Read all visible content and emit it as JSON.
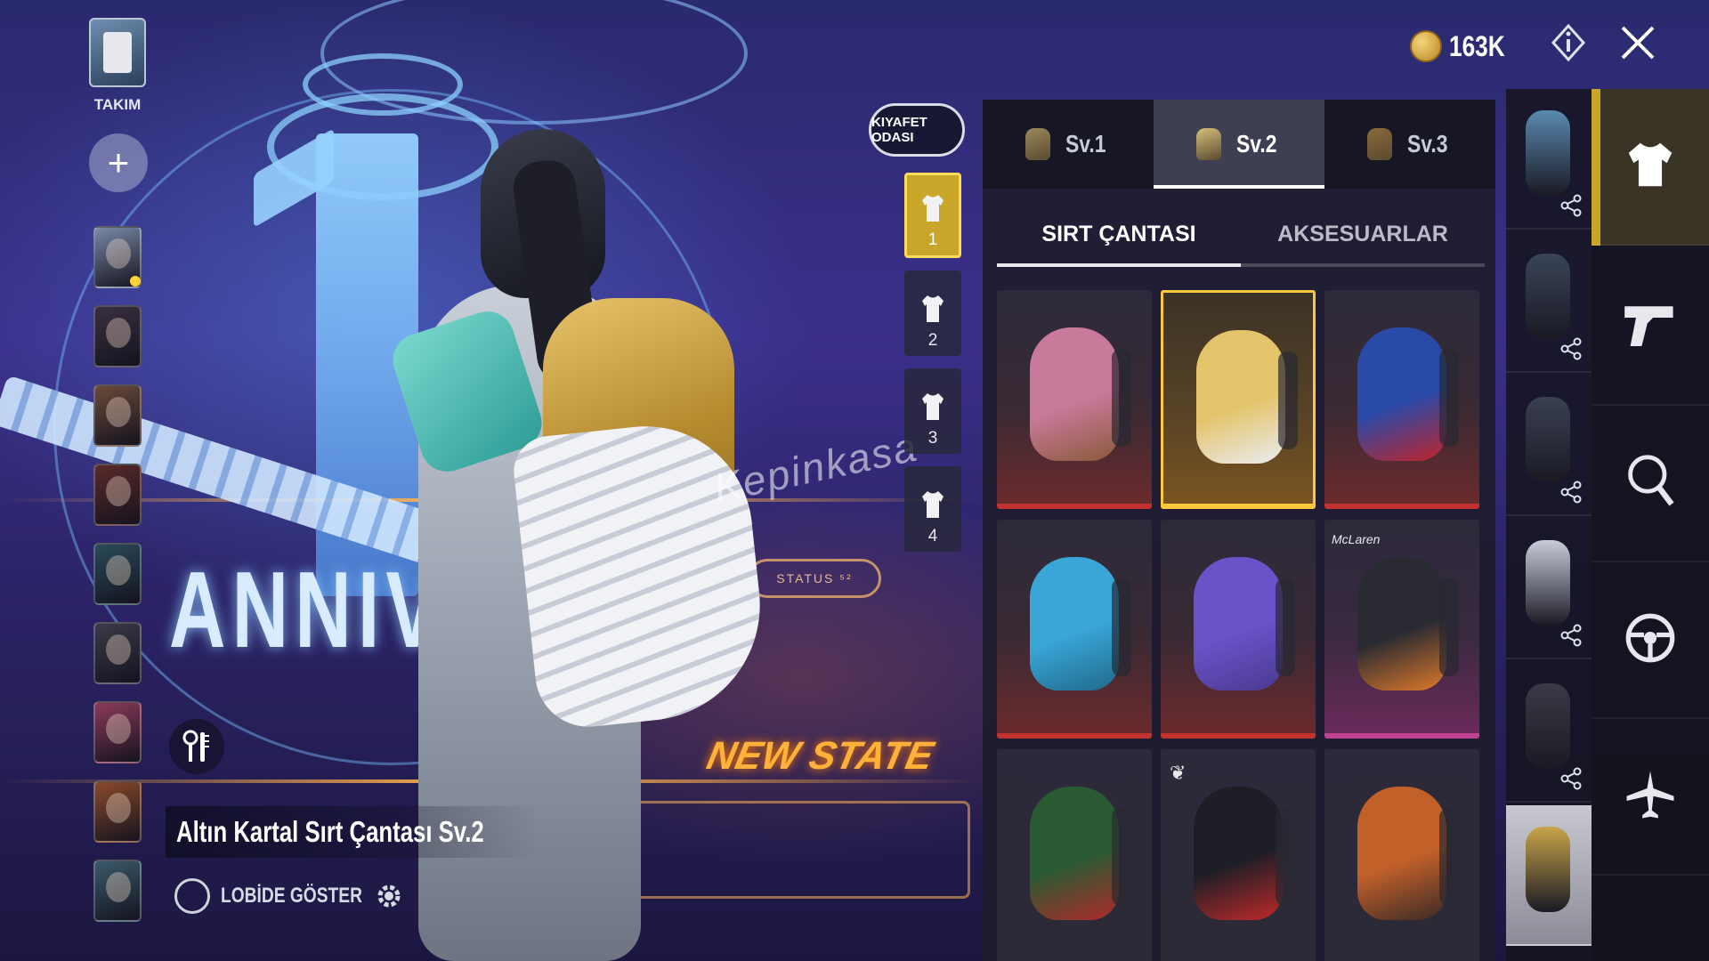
{
  "lobby": {
    "team_label": "TAKIM",
    "scene_text": "ANNIVERS",
    "newstate_sign": "NEW STATE",
    "status_sign": "STATUS ⁵²",
    "watermark": "Kepinkasa",
    "avatars": 9
  },
  "item": {
    "name": "Altın Kartal Sırt Çantası Sv.2",
    "lobby_toggle_label": "LOBİDE GÖSTER",
    "lobby_toggle_on": false
  },
  "header": {
    "currency_value": "163K",
    "info_icon": "diamond-info-icon",
    "close_icon": "close-icon"
  },
  "outfit": {
    "room_label": "KIYAFET ODASI",
    "slots": [
      {
        "label": "1",
        "active": true
      },
      {
        "label": "2",
        "active": false
      },
      {
        "label": "3",
        "active": false
      },
      {
        "label": "4",
        "active": false
      }
    ]
  },
  "panel": {
    "level_tabs": [
      {
        "label": "Sv.1",
        "active": false
      },
      {
        "label": "Sv.2",
        "active": true
      },
      {
        "label": "Sv.3",
        "active": false
      }
    ],
    "sub_tabs": [
      {
        "label": "SIRT ÇANTASI",
        "active": true
      },
      {
        "label": "AKSESUARLAR",
        "active": false
      }
    ],
    "items": [
      {
        "name": "ice-cream-backpack",
        "color": "#c9799a",
        "accent": "#8a5a3a",
        "rarity": "red",
        "selected": false
      },
      {
        "name": "golden-eagle-backpack",
        "color": "#e4c46a",
        "accent": "#e9ecf2",
        "rarity": "gold",
        "selected": true
      },
      {
        "name": "shield-backpack",
        "color": "#2a4aa8",
        "accent": "#c0242a",
        "rarity": "red",
        "selected": false
      },
      {
        "name": "spiked-blue-backpack",
        "color": "#3aa6d8",
        "accent": "#1f6a8a",
        "rarity": "red",
        "selected": false
      },
      {
        "name": "purple-bear-backpack",
        "color": "#6a52c8",
        "accent": "#4a3a90",
        "rarity": "red",
        "selected": false
      },
      {
        "name": "mclaren-backpack",
        "color": "#2a2a32",
        "accent": "#e07a2a",
        "rarity": "pink",
        "brand": "McLaren",
        "selected": false
      },
      {
        "name": "reindeer-backpack",
        "color": "#2a5a32",
        "accent": "#b02a2a",
        "rarity": "plain",
        "selected": false
      },
      {
        "name": "winged-black-backpack",
        "color": "#1e1e26",
        "accent": "#c02a2a",
        "rarity": "plain",
        "selected": false
      },
      {
        "name": "pumpkin-backpack",
        "color": "#c2602a",
        "accent": "#3a2a26",
        "rarity": "plain",
        "selected": false
      }
    ]
  },
  "preview": [
    {
      "name": "preview-outfit-armor",
      "color": "#5a8ab0"
    },
    {
      "name": "preview-outfit-dark",
      "color": "#3a4458"
    },
    {
      "name": "preview-outfit-dark-2",
      "color": "#3a4052"
    },
    {
      "name": "preview-pants-white",
      "color": "#c8ccd8"
    },
    {
      "name": "preview-pants-dark",
      "color": "#3a3a46"
    },
    {
      "name": "preview-backpack-gold",
      "color": "#c8a44a"
    }
  ],
  "categories": [
    {
      "name": "shirt-icon",
      "active": true
    },
    {
      "name": "pistol-icon",
      "active": false
    },
    {
      "name": "pan-icon",
      "active": false
    },
    {
      "name": "steering-wheel-icon",
      "active": false
    },
    {
      "name": "airplane-icon",
      "active": false
    }
  ]
}
